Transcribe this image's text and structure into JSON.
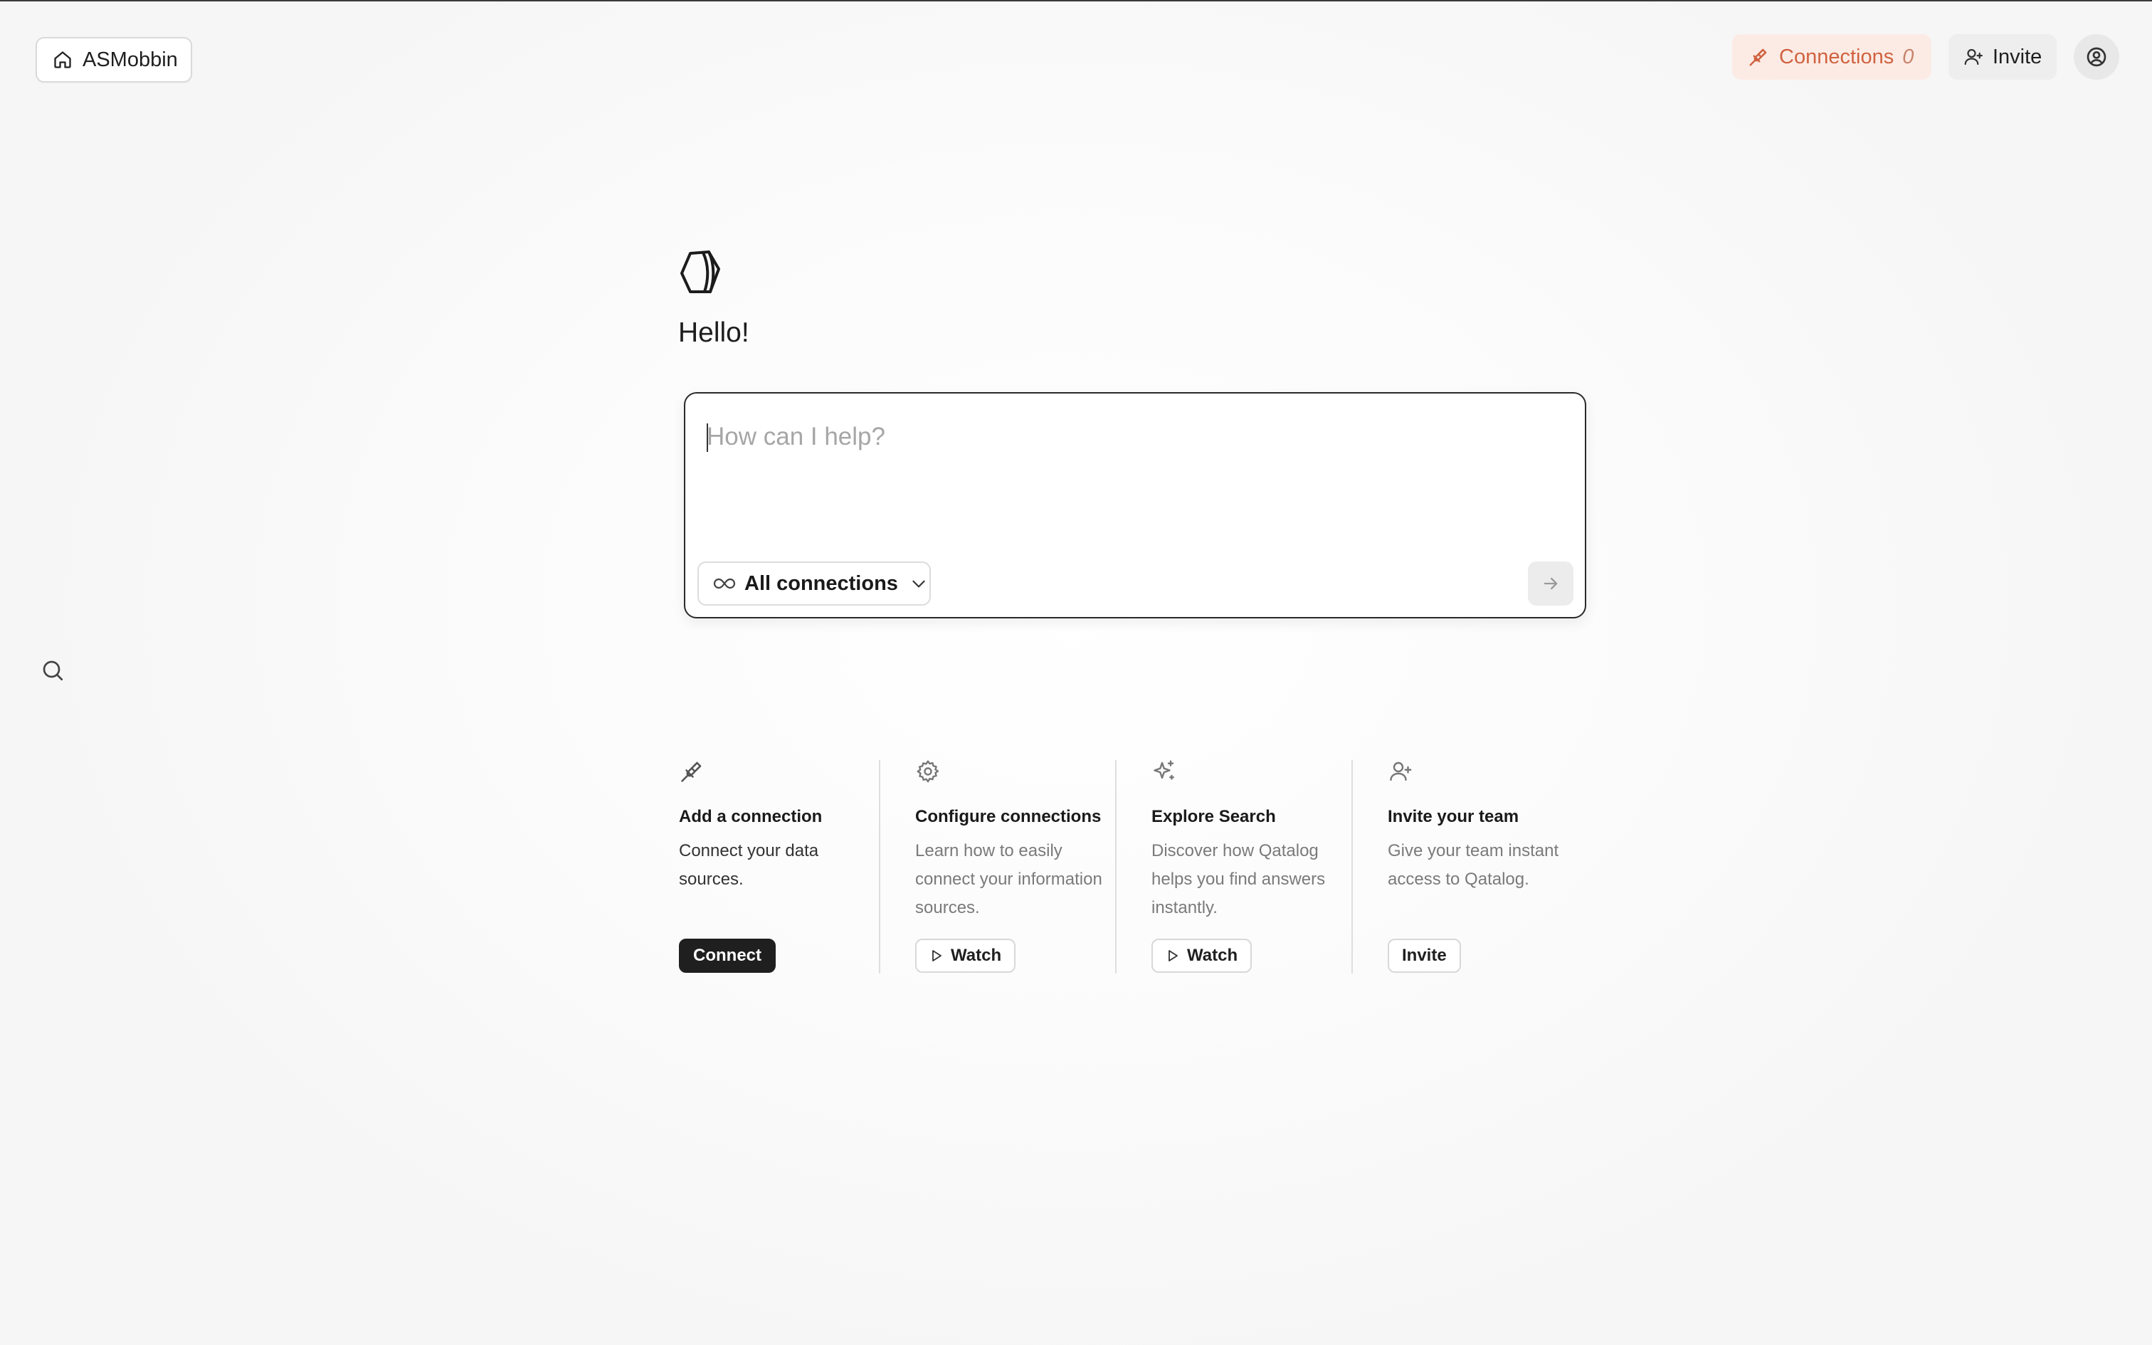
{
  "header": {
    "workspace": {
      "label": "ASMobbin",
      "icon": "home-icon"
    },
    "connections": {
      "label": "Connections",
      "count": "0",
      "icon": "plug-icon",
      "color": "#d0623f"
    },
    "invite": {
      "label": "Invite",
      "icon": "user-plus-icon"
    },
    "avatar": {
      "icon": "user-circle-icon"
    }
  },
  "sidebar": {
    "search_icon": "search-icon"
  },
  "hero": {
    "logo_icon": "qatalog-logo-icon",
    "greeting": "Hello!"
  },
  "prompt": {
    "placeholder": "How can I help?",
    "value": "",
    "scope": {
      "label": "All connections",
      "icon": "infinity-icon",
      "chevron": "chevron-down-icon"
    },
    "send_icon": "arrow-right-icon"
  },
  "cards": [
    {
      "icon": "plug-icon",
      "title": "Add a connection",
      "description": "Connect your data sources.",
      "action": "Connect"
    },
    {
      "icon": "gear-icon",
      "title": "Configure connections",
      "description": "Learn how to easily connect your information sources.",
      "action": "Watch"
    },
    {
      "icon": "sparkle-icon",
      "title": "Explore Search",
      "description": "Discover how Qatalog helps you find answers instantly.",
      "action": "Watch"
    },
    {
      "icon": "user-plus-icon",
      "title": "Invite your team",
      "description": "Give your team instant access to Qatalog.",
      "action": "Invite"
    }
  ]
}
